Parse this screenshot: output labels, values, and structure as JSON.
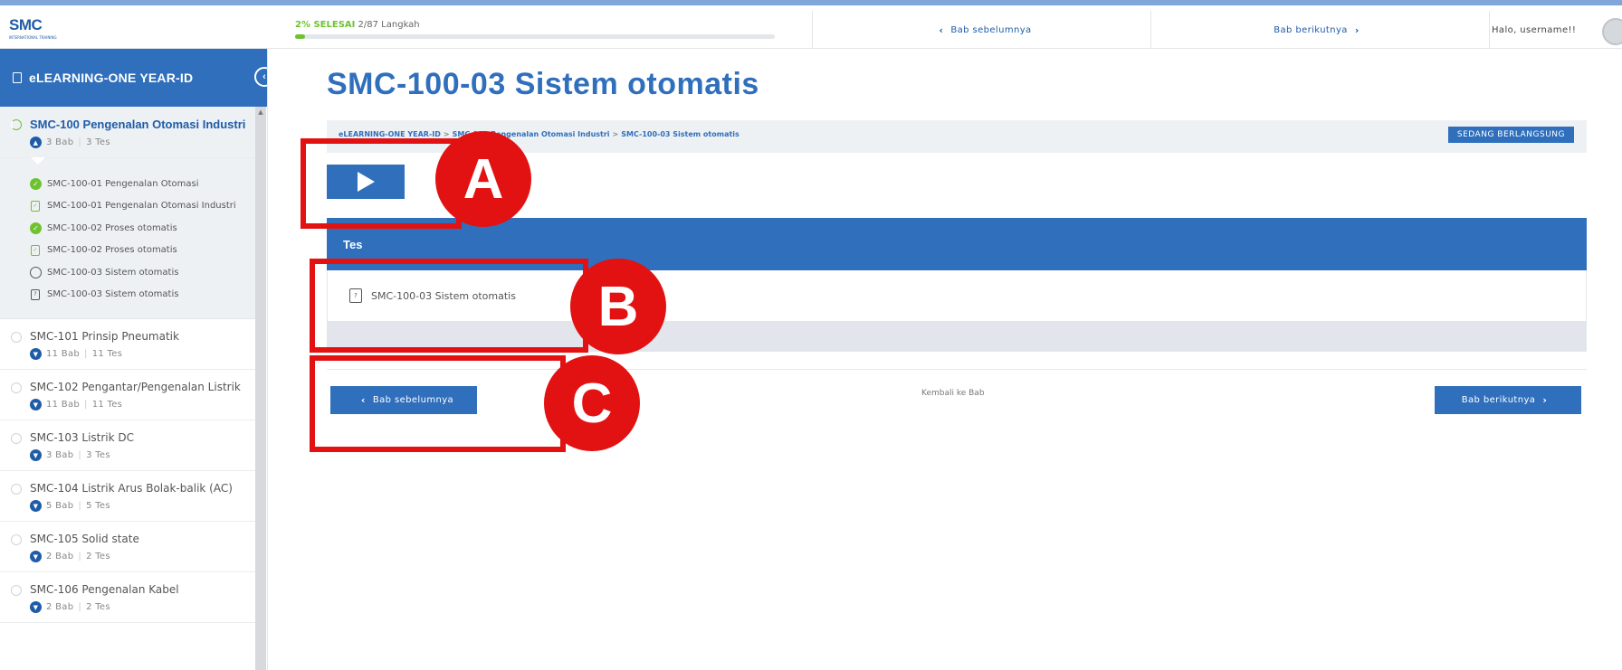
{
  "topbar": {
    "logo_mark": "SMC",
    "logo_sub": "INTERNATIONAL TRAINING",
    "progress_pct_label": "2% SELESAI",
    "progress_steps": "2/87 Langkah",
    "progress_fraction": 0.02,
    "prev_label": "Bab sebelumnya",
    "next_label": "Bab berikutnya",
    "greeting": "Halo, username!!"
  },
  "sidebar": {
    "header": "eLEARNING-ONE YEAR-ID",
    "active_course": {
      "title": "SMC-100 Pengenalan Otomasi Industri",
      "bab": "3 Bab",
      "tes": "3 Tes",
      "lessons": [
        {
          "label": "SMC-100-01 Pengenalan Otomasi",
          "status": "done"
        },
        {
          "label": "SMC-100-01 Pengenalan Otomasi Industri",
          "status": "quiz-done"
        },
        {
          "label": "SMC-100-02 Proses otomatis",
          "status": "done"
        },
        {
          "label": "SMC-100-02 Proses otomatis",
          "status": "quiz-done"
        },
        {
          "label": "SMC-100-03 Sistem otomatis",
          "status": "open"
        },
        {
          "label": "SMC-100-03 Sistem otomatis",
          "status": "quiz-open"
        }
      ]
    },
    "courses": [
      {
        "title": "SMC-101 Prinsip Pneumatik",
        "bab": "11 Bab",
        "tes": "11 Tes"
      },
      {
        "title": "SMC-102 Pengantar/Pengenalan Listrik",
        "bab": "11 Bab",
        "tes": "11 Tes"
      },
      {
        "title": "SMC-103 Listrik DC",
        "bab": "3 Bab",
        "tes": "3 Tes"
      },
      {
        "title": "SMC-104 Listrik Arus Bolak-balik (AC)",
        "bab": "5 Bab",
        "tes": "5 Tes"
      },
      {
        "title": "SMC-105 Solid state",
        "bab": "2 Bab",
        "tes": "2 Tes"
      },
      {
        "title": "SMC-106 Pengenalan Kabel",
        "bab": "2 Bab",
        "tes": "2 Tes"
      }
    ]
  },
  "main": {
    "title": "SMC-100-03 Sistem otomatis",
    "breadcrumb": [
      "eLEARNING-ONE YEAR-ID",
      "SMC-100 Pengenalan Otomasi Industri",
      "SMC-100-03 Sistem otomatis"
    ],
    "status_badge": "SEDANG BERLANGSUNG",
    "tes_header": "Tes",
    "tes_item": "SMC-100-03 Sistem otomatis",
    "nav_prev": "Bab sebelumnya",
    "nav_back": "Kembali ke Bab",
    "nav_next": "Bab berikutnya"
  },
  "callouts": [
    "A",
    "B",
    "C"
  ],
  "colors": {
    "accent": "#2f6fbc",
    "success": "#6ec230",
    "callout": "#e21212"
  }
}
